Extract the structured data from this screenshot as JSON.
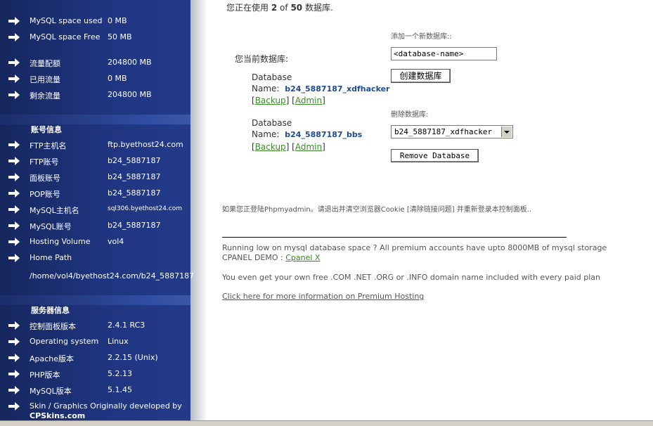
{
  "usage": {
    "prefix": "您正在使用",
    "current": "2",
    "of": "of",
    "max": "50",
    "suffix": "数据库."
  },
  "sidebar": {
    "stats_top": [
      {
        "label": "MySQL space used",
        "value": "0 MB"
      },
      {
        "label": "MySQL space Free",
        "value": "50 MB"
      }
    ],
    "stats_traffic": [
      {
        "label": "流量配额",
        "value": "204800 MB"
      },
      {
        "label": "已用流量",
        "value": "0 MB"
      },
      {
        "label": "剩余流量",
        "value": "204800 MB"
      }
    ],
    "account_title": "账号信息",
    "account": [
      {
        "label": "FTP主机名",
        "value": "ftp.byethost24.com"
      },
      {
        "label": "FTP账号",
        "value": "b24_5887187"
      },
      {
        "label": "面板账号",
        "value": "b24_5887187"
      },
      {
        "label": "POP账号",
        "value": "b24_5887187"
      },
      {
        "label": "MySQL主机名",
        "value": "sql306.byethost24.com"
      },
      {
        "label": "MySQL账号",
        "value": "b24_5887187"
      },
      {
        "label": "Hosting Volume",
        "value": "vol4"
      },
      {
        "label": "Home Path",
        "value": ""
      }
    ],
    "home_path_value": "/home/vol4/byethost24.com/b24_5887187",
    "server_title": "服务器信息",
    "server": [
      {
        "label": "控制面板版本",
        "value": "2.4.1 RC3"
      },
      {
        "label": "Operating system",
        "value": "Linux"
      },
      {
        "label": "Apache版本",
        "value": "2.2.15 (Unix)"
      },
      {
        "label": "PHP版本",
        "value": "5.2.13"
      },
      {
        "label": "MySQL版本",
        "value": "5.1.45"
      }
    ],
    "credits_line1": "Skin / Graphics Originally developed by",
    "credits_line2": "CPSkins.com"
  },
  "current_db": {
    "title": "您当前数据库:",
    "databases": [
      {
        "label1": "Database",
        "label2": "Name:",
        "name": "b24_5887187_xdfhacker",
        "backup": "Backup",
        "admin": "Admin"
      },
      {
        "label1": "Database",
        "label2": "Name:",
        "name": "b24_5887187_bbs",
        "backup": "Backup",
        "admin": "Admin"
      }
    ]
  },
  "create_db": {
    "label": "添加一个新数据库::",
    "input_value": "<database-name>",
    "button": "创建数据库"
  },
  "remove_db": {
    "label": "删除数据库:",
    "selected": "b24_5887187_xdfhacker",
    "button": "Remove Database"
  },
  "notice": "如果您正登陆Phpmyadmin。请退出并清空浏览器Cookie [清除链接问题] 并重新登录本控制面板..",
  "promo": {
    "line1": "Running low on mysql database space ? All premium accounts have upto 8000MB of mysql storage",
    "demo_prefix": "CPANEL DEMO : ",
    "demo_link": "Cpanel X",
    "line3": "You even get your own free .COM .NET .ORG or .INFO domain name included with every paid plan",
    "more_link": "Click here for more information on Premium Hosting"
  },
  "icons": {
    "arrow": "arrow-right-icon"
  },
  "colors": {
    "sidebar": "#1f3580",
    "link": "#3a8a2a",
    "db_name": "#1f4c8c"
  }
}
